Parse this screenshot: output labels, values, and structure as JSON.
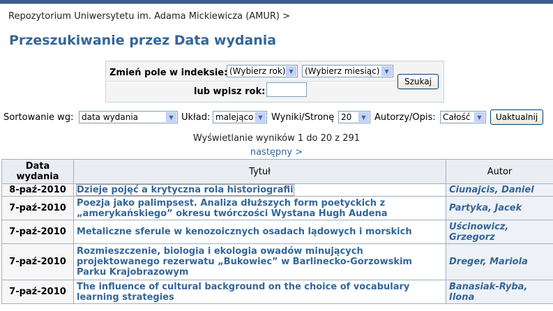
{
  "breadcrumb": {
    "repo": "Repozytorium Uniwersytetu im. Adama Mickiewicza (AMUR)",
    "sep": ">"
  },
  "page_title": "Przeszukiwanie przez Data wydania",
  "index_form": {
    "change_label": "Zmień pole w indeksie:",
    "year_select": "(Wybierz rok)",
    "month_select": "(Wybierz miesiąc)",
    "or_year_label": "lub wpisz rok:",
    "year_value": "",
    "search_button": "Szukaj"
  },
  "sort_bar": {
    "sort_label": "Sortowanie wg:",
    "sort_value": "data wydania",
    "order_label": "Układ:",
    "order_value": "malejąco",
    "per_page_label": "Wyniki/Stronę",
    "per_page_value": "20",
    "authors_label": "Autorzy/Opis:",
    "authors_value": "Całość",
    "update_button": "Uaktualnij"
  },
  "results_info": "Wyświetlanie wyników 1 do 20 z 291",
  "next_link": "następny >",
  "table": {
    "headers": {
      "date_line1": "Data",
      "date_line2": "wydania",
      "title": "Tytuł",
      "author": "Autor"
    },
    "rows": [
      {
        "date": "8-paź-2010",
        "title": "Dzieje pojęć a krytyczna rola historiografii",
        "author": "Ciunajcis, Daniel"
      },
      {
        "date": "7-paź-2010",
        "title": "Poezja jako palimpsest. Analiza dłuższych form poetyckich z „amerykańskiego” okresu twórczości Wystana Hugh Audena",
        "author": "Partyka, Jacek"
      },
      {
        "date": "7-paź-2010",
        "title": "Metaliczne sferule w kenozoicznych osadach lądowych i morskich",
        "author": "Uścinowicz, Grzegorz"
      },
      {
        "date": "7-paź-2010",
        "title": "Rozmieszczenie, biologia i ekologia owadów minujących projektowanego rezerwatu „Bukowiec” w Barlinecko-Gorzowskim Parku Krajobrazowym",
        "author": "Dreger, Mariola"
      },
      {
        "date": "7-paź-2010",
        "title": "The influence of cultural background on the choice of vocabulary learning strategies",
        "author": "Banasiak-Ryba, Ilona"
      }
    ]
  }
}
